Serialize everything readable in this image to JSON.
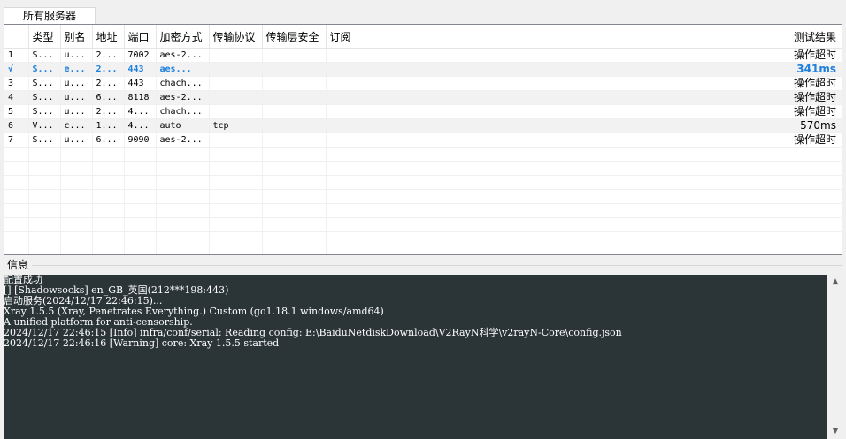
{
  "tabs": [
    {
      "label": "所有服务器"
    }
  ],
  "grid": {
    "columns": [
      "",
      "类型",
      "别名",
      "地址",
      "端口",
      "加密方式",
      "传输协议",
      "传输层安全",
      "订阅",
      "测试结果"
    ],
    "rows": [
      {
        "idx": "1",
        "type": "S...",
        "alias": "u...",
        "address": "2...",
        "port": "7002",
        "security": "aes-2...",
        "network": "",
        "tls": "",
        "sub": "",
        "result": "操作超时",
        "active": false
      },
      {
        "idx": "√",
        "type": "S...",
        "alias": "e...",
        "address": "2...",
        "port": "443",
        "security": "aes...",
        "network": "",
        "tls": "",
        "sub": "",
        "result": "341ms",
        "active": true
      },
      {
        "idx": "3",
        "type": "S...",
        "alias": "u...",
        "address": "2...",
        "port": "443",
        "security": "chach...",
        "network": "",
        "tls": "",
        "sub": "",
        "result": "操作超时",
        "active": false
      },
      {
        "idx": "4",
        "type": "S...",
        "alias": "u...",
        "address": "6...",
        "port": "8118",
        "security": "aes-2...",
        "network": "",
        "tls": "",
        "sub": "",
        "result": "操作超时",
        "active": false
      },
      {
        "idx": "5",
        "type": "S...",
        "alias": "u...",
        "address": "2...",
        "port": "4...",
        "security": "chach...",
        "network": "",
        "tls": "",
        "sub": "",
        "result": "操作超时",
        "active": false
      },
      {
        "idx": "6",
        "type": "V...",
        "alias": "c...",
        "address": "1...",
        "port": "4...",
        "security": "auto",
        "network": "tcp",
        "tls": "",
        "sub": "",
        "result": "570ms",
        "active": false
      },
      {
        "idx": "7",
        "type": "S...",
        "alias": "u...",
        "address": "6...",
        "port": "9090",
        "security": "aes-2...",
        "network": "",
        "tls": "",
        "sub": "",
        "result": "操作超时",
        "active": false
      }
    ]
  },
  "info": {
    "label": "信息",
    "lines": [
      "配置成功",
      "[] [Shadowsocks] en_GB_英国(212***198:443)",
      "启动服务(2024/12/17 22:46:15)...",
      "Xray 1.5.5 (Xray, Penetrates Everything.) Custom (go1.18.1 windows/amd64)",
      "A unified platform for anti-censorship.",
      "2024/12/17 22:46:15 [Info] infra/conf/serial: Reading config: E:\\BaiduNetdiskDownload\\V2RayN科学\\v2rayN-Core\\config.json",
      "2024/12/17 22:46:16 [Warning] core: Xray 1.5.5 started"
    ]
  },
  "scrollbar": {
    "up_icon": "▲",
    "down_icon": "▼"
  }
}
